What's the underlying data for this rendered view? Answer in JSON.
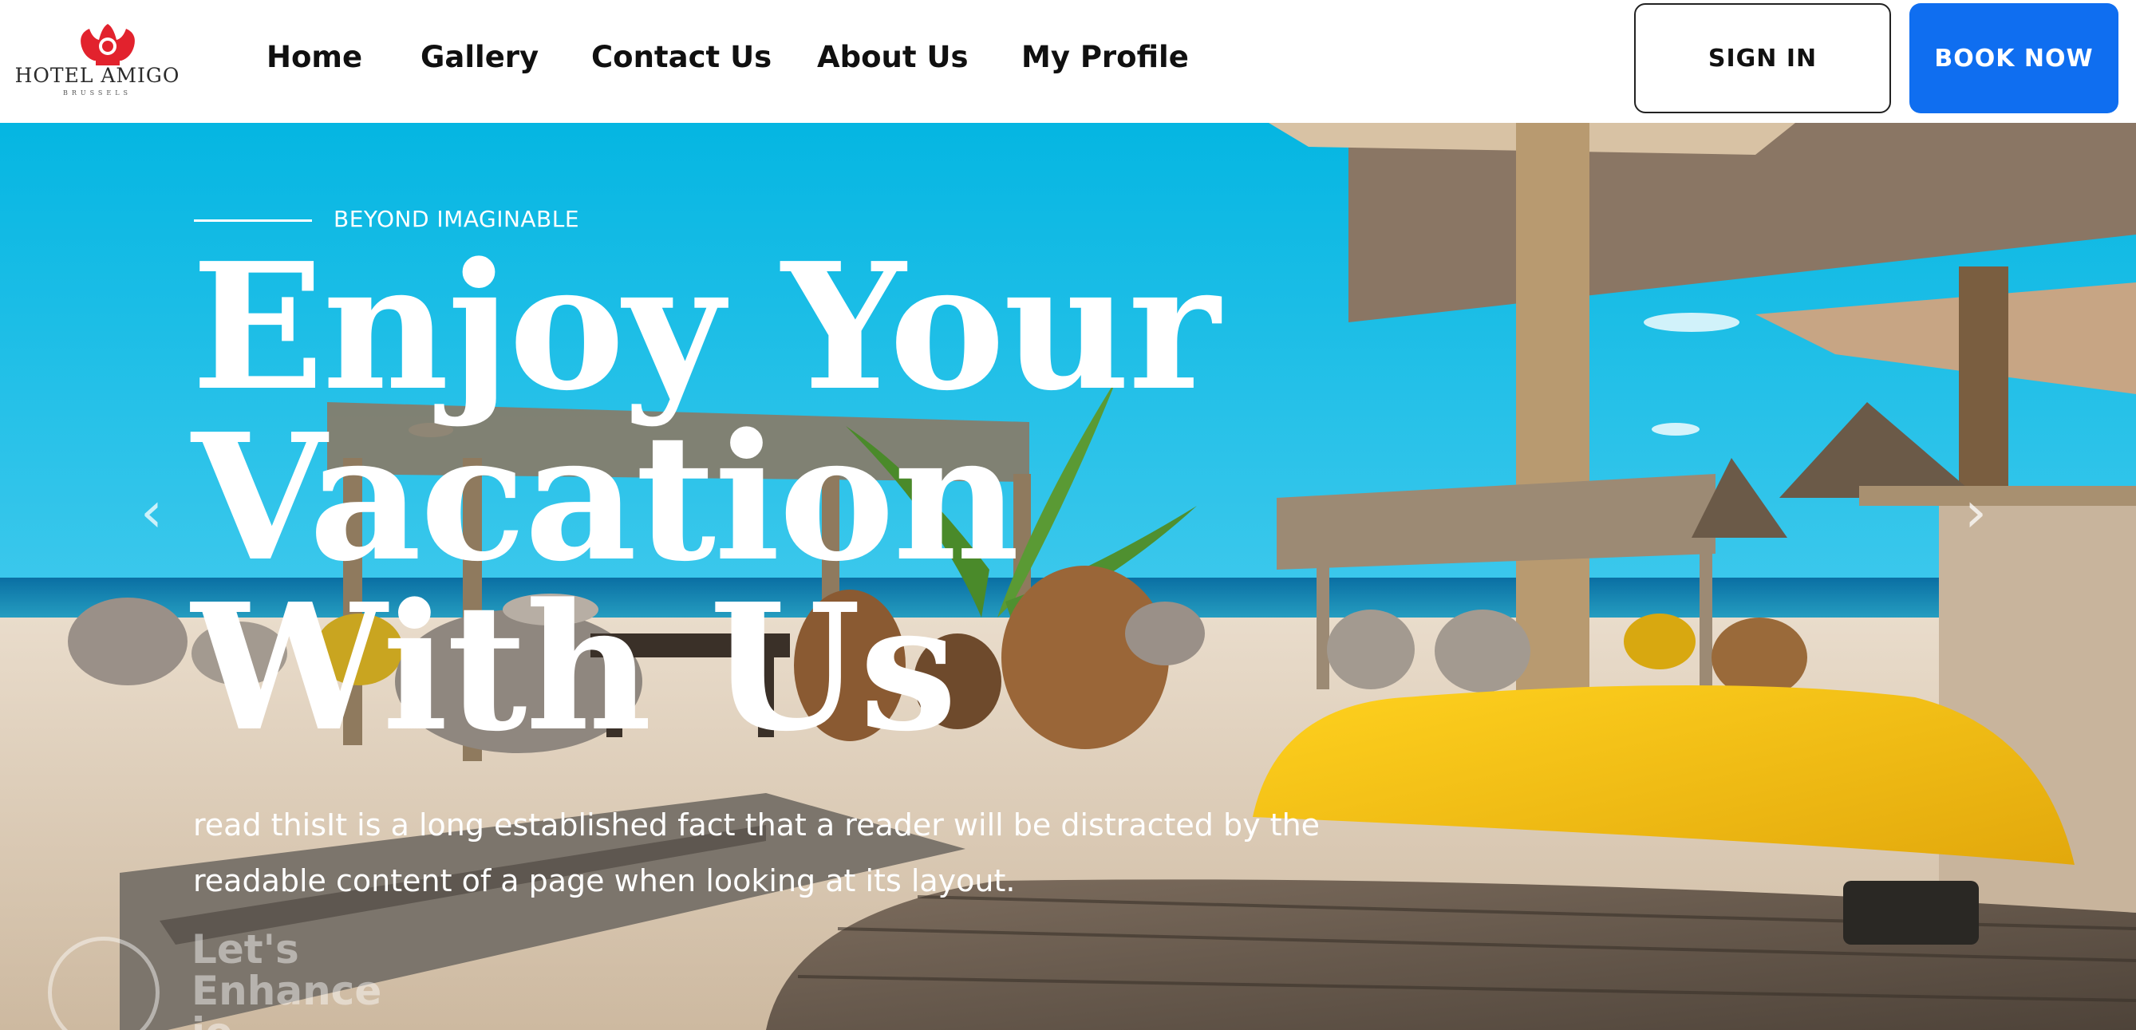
{
  "brand": {
    "name": "HOTEL AMIGO",
    "subtitle": "BRUSSELS",
    "crest_icon": "lion-crest-icon",
    "brand_color": "#e2222d"
  },
  "nav": {
    "items": [
      {
        "label": "Home"
      },
      {
        "label": "Gallery"
      },
      {
        "label": "Contact Us"
      },
      {
        "label": "About Us"
      },
      {
        "label": "My Profile"
      }
    ]
  },
  "actions": {
    "sign_in": "SIGN IN",
    "book_now": "BOOK NOW",
    "book_color": "#0f6ef0"
  },
  "hero": {
    "eyebrow": "BEYOND IMAGINABLE",
    "headline_lines": [
      "Enjoy Your",
      "Vacation",
      "With Us"
    ],
    "description": "read thisIt is a long established fact that a reader will be distracted by the readable content of a page when looking at its layout.",
    "prev_icon": "chevron-left-icon",
    "next_icon": "chevron-right-icon",
    "prev_glyph": "‹",
    "next_glyph": "›"
  },
  "watermark": {
    "text": "Let's Enhance io",
    "lines": [
      "Let's",
      "Enhance",
      "io"
    ]
  }
}
